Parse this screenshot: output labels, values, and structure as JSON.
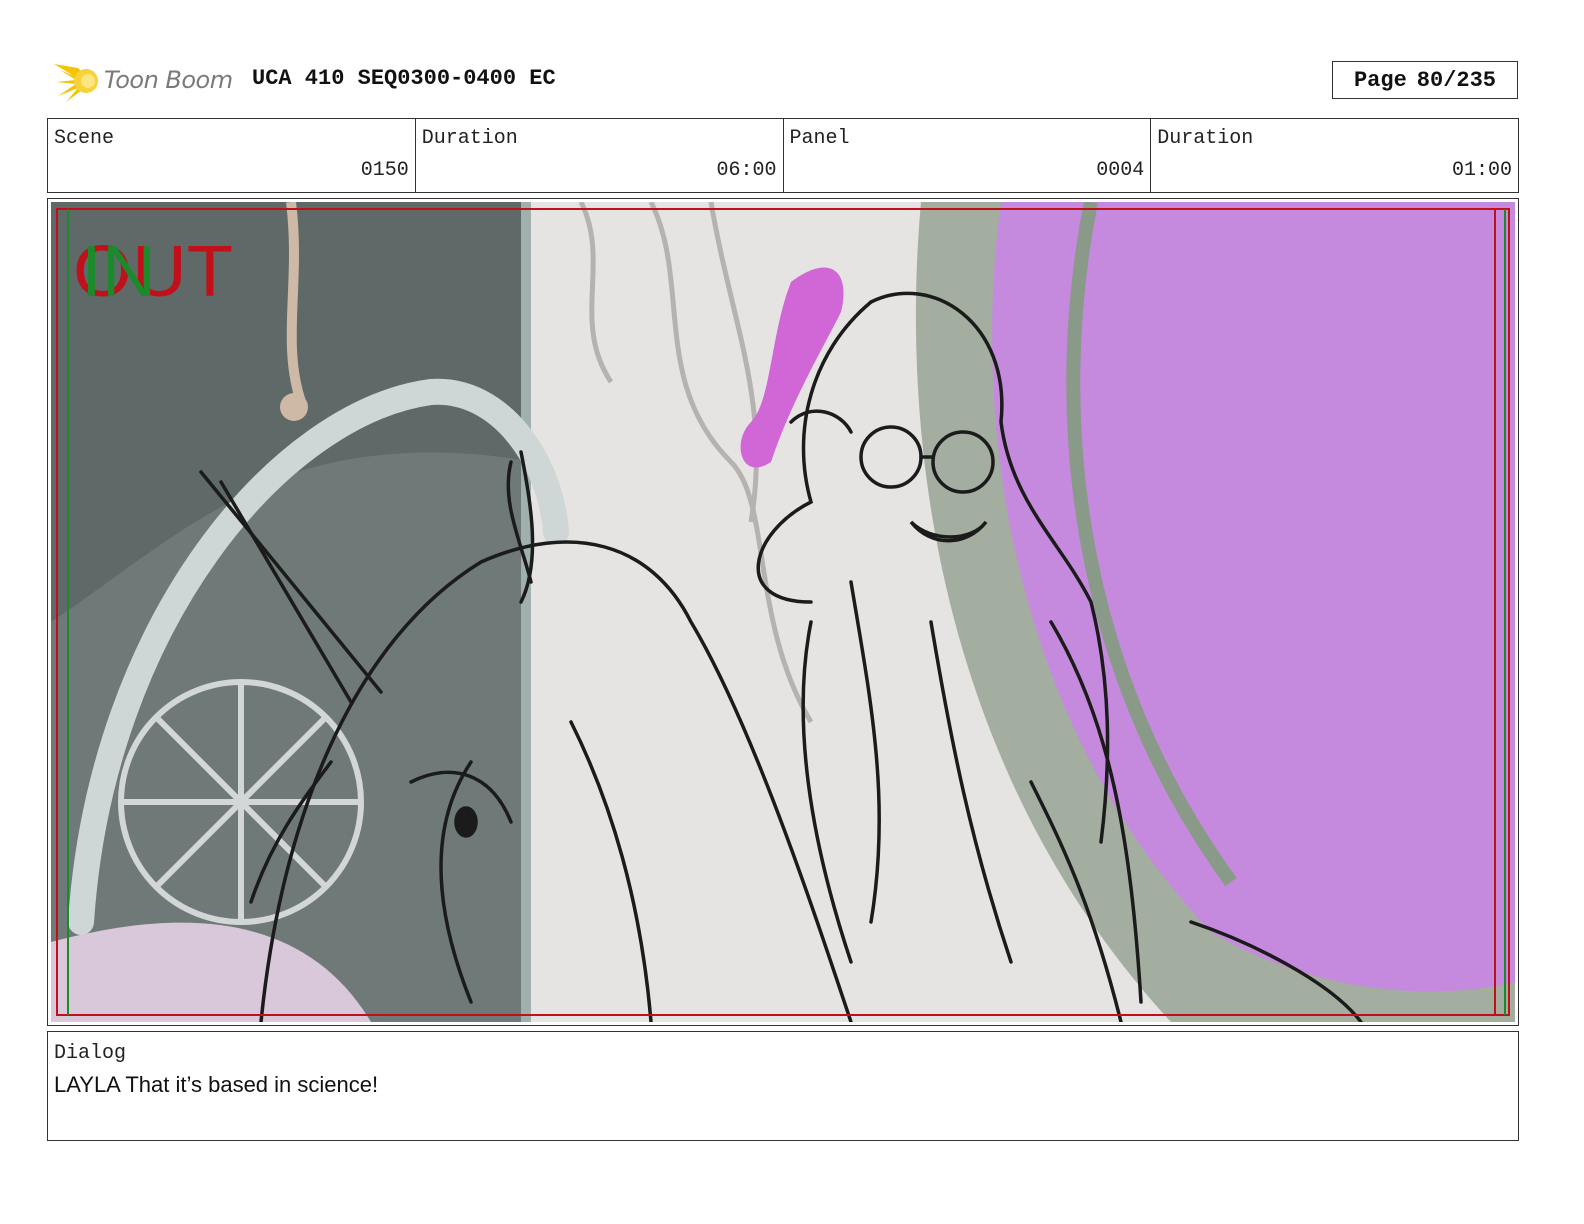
{
  "header": {
    "logo_text": "Toon Boom",
    "project_title": "UCA 410 SEQ0300-0400 EC",
    "page_label": "Page",
    "page_number": "80/235"
  },
  "info": {
    "scene_label": "Scene",
    "scene_value": "0150",
    "scene_duration_label": "Duration",
    "scene_duration_value": "06:00",
    "panel_label": "Panel",
    "panel_value": "0004",
    "panel_duration_label": "Duration",
    "panel_duration_value": "01:00"
  },
  "panel": {
    "out_label": "OUT",
    "in_label": "IN"
  },
  "dialog": {
    "label": "Dialog",
    "text": "LAYLA That it’s based in science!"
  },
  "colors": {
    "safe_frame_red": "#c0101a",
    "safe_frame_green": "#1a8a2a",
    "portal_purple": "#c58ade",
    "logo_yellow": "#f5c400"
  },
  "icons": {
    "logo": "toon-boom-starburst-icon"
  }
}
